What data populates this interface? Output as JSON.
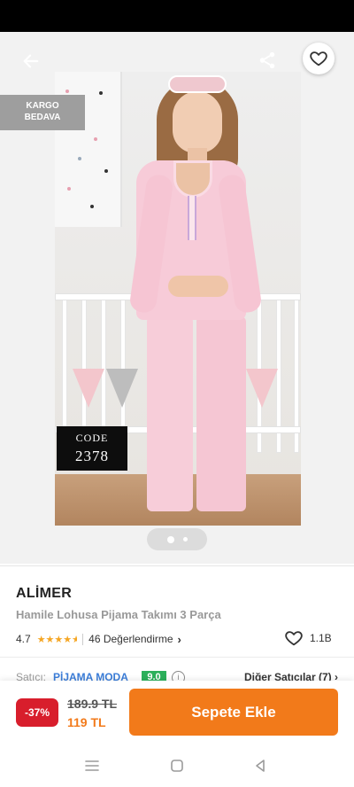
{
  "colors": {
    "accent": "#f27a1a",
    "discount_bg": "#d81e2c",
    "seller_link": "#3b7dd8",
    "seller_score_bg": "#2cb05b",
    "star": "#f5a623",
    "badge_bg": "#9e9e9e"
  },
  "icons": {
    "back": "arrow-left-icon",
    "share": "share-icon",
    "favorite": "heart-outline-icon",
    "info": "info-icon",
    "chevron": "chevron-right-icon",
    "nav_menu": "menu-icon",
    "nav_home": "square-icon",
    "nav_back": "triangle-back-icon"
  },
  "gallery": {
    "badge_line1": "KARGO",
    "badge_line2": "BEDAVA",
    "code_label": "CODE",
    "code_number": "2378",
    "page_count": 2,
    "active_page": 1
  },
  "product": {
    "brand": "ALİMER",
    "name": "Hamile Lohusa Pijama Takımı 3 Parça",
    "rating": "4.7",
    "rating_value": 4.7,
    "reviews": "46 Değerlendirme",
    "likes": "1.1B"
  },
  "seller": {
    "prefix": "Satıcı:",
    "name": "PİJAMA MODA",
    "score": "9.0",
    "other_sellers": "Diğer Satıcılar (7)"
  },
  "purchase": {
    "discount": "-37%",
    "old_price": "189.9 TL",
    "new_price": "119 TL",
    "add_to_cart": "Sepete Ekle"
  }
}
